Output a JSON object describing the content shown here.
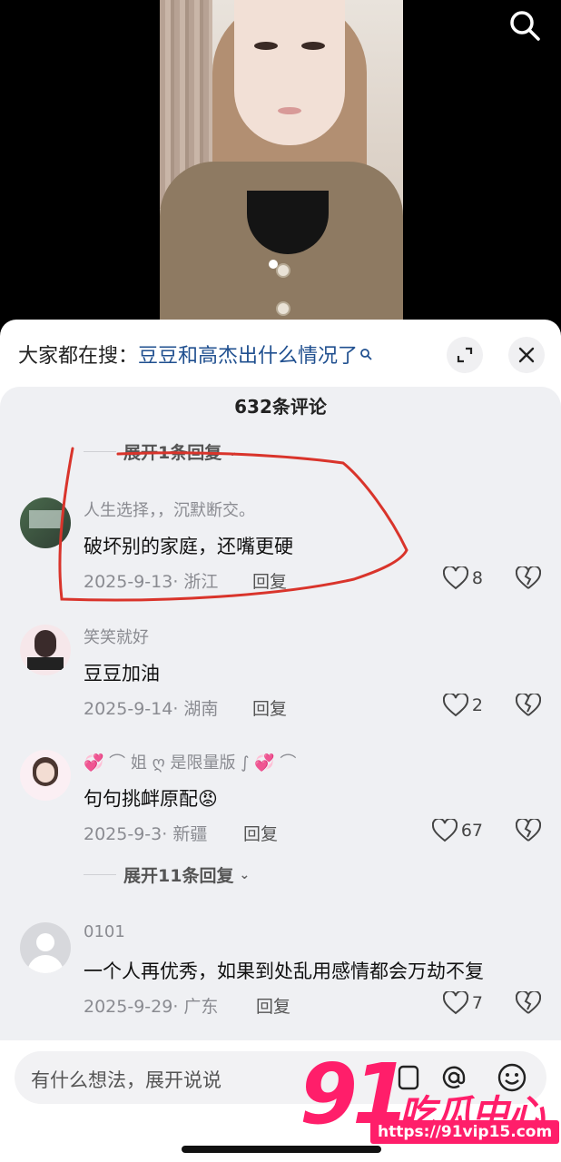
{
  "search_bar": {
    "prefix": "大家都在搜：",
    "query": "豆豆和高杰出什么情况了"
  },
  "comments_header": {
    "count_label": "632条评论"
  },
  "expand_top": {
    "label": "展开1条回复"
  },
  "comments": [
    {
      "user": "人生选择，，沉默断交。",
      "text": "破坏别的家庭，还嘴更硬",
      "date_location": "2025-9-13· 浙江",
      "reply": "回复",
      "likes": "8"
    },
    {
      "user": "笑笑就好",
      "text": "豆豆加油",
      "date_location": "2025-9-14· 湖南",
      "reply": "回复",
      "likes": "2"
    },
    {
      "user": "💞 ⌒ 姐 ღ 是限量版 ∫ 💞 ⌒",
      "text": "句句挑衅原配😡",
      "date_location": "2025-9-3· 新疆",
      "reply": "回复",
      "likes": "67"
    },
    {
      "user": "0101",
      "text": "一个人再优秀，如果到处乱用感情都会万劫不复",
      "date_location": "2025-9-29· 广东",
      "reply": "回复",
      "likes": "7"
    }
  ],
  "expand_mid": {
    "label": "展开11条回复"
  },
  "input": {
    "placeholder": "有什么想法，展开说说"
  },
  "watermark": {
    "number": "91",
    "text": "吃瓜中心",
    "url": "https://91vip15.com"
  },
  "colors": {
    "accent": "#ff1e6a",
    "link": "#1f4f8f",
    "annotation": "#d9342b"
  }
}
